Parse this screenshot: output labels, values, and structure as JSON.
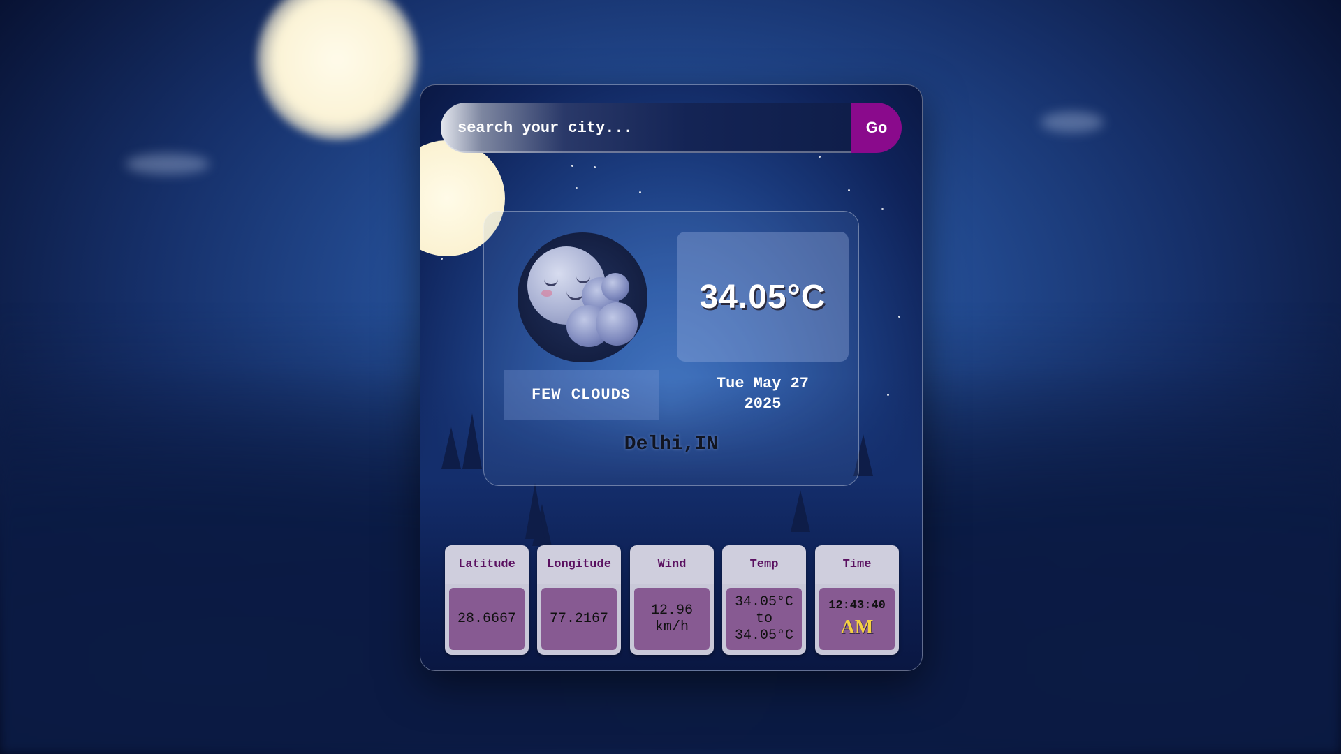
{
  "search": {
    "placeholder": "search your city...",
    "button_label": "Go"
  },
  "weather": {
    "temperature": "34.05°C",
    "condition": "FEW CLOUDS",
    "date_line1": "Tue May 27",
    "date_line2": "2025",
    "location": "Delhi,IN",
    "icon": "moon-with-clouds-icon"
  },
  "stats": {
    "latitude": {
      "label": "Latitude",
      "value": "28.6667"
    },
    "longitude": {
      "label": "Longitude",
      "value": "77.2167"
    },
    "wind": {
      "label": "Wind",
      "value_line1": "12.96",
      "value_line2": "km/h"
    },
    "temp": {
      "label": "Temp",
      "value_line1": "34.05°C",
      "value_line2": "to",
      "value_line3": "34.05°C"
    },
    "time": {
      "label": "Time",
      "clock": "12:43:40",
      "ampm": "AM"
    }
  },
  "colors": {
    "go_button": "#8a0a8c",
    "stat_label_text": "#5a1060",
    "stat_value_bg": "#875a92",
    "ampm_text": "#f5d142"
  }
}
